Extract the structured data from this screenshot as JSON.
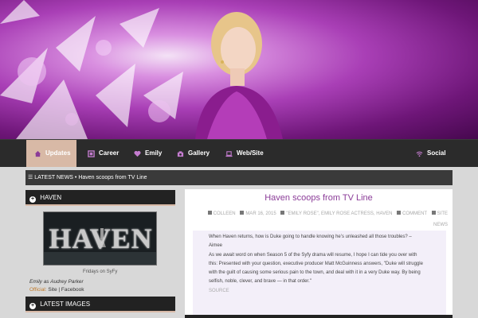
{
  "nav": {
    "items": [
      {
        "label": "Updates",
        "icon": "home-icon",
        "active": true
      },
      {
        "label": "Career",
        "icon": "film-icon"
      },
      {
        "label": "Emily",
        "icon": "heart-icon"
      },
      {
        "label": "Gallery",
        "icon": "camera-icon"
      },
      {
        "label": "Web/Site",
        "icon": "laptop-icon"
      },
      {
        "label": "Social",
        "icon": "wifi-icon"
      }
    ]
  },
  "ticker": {
    "prefix": "☰ LATEST NEWS •",
    "headline": "Haven scoops from TV Line"
  },
  "sidebar": {
    "haven_widget": {
      "title": "HAVEN",
      "logo_text": "HAVEN",
      "caption": "Fridays on SyFy",
      "role": "Emily as Audrey Parker",
      "official_label": "Official:",
      "site_link": "Site",
      "separator": "|",
      "facebook_link": "Facebook"
    },
    "images_widget": {
      "title": "LATEST IMAGES"
    }
  },
  "post": {
    "title": "Haven scoops from TV Line",
    "author": "COLLEEN",
    "date": "MAR 16, 2015",
    "tags": "\"EMILY ROSE\", EMILY ROSE ACTRESS, HAVEN",
    "comment": "COMMENT",
    "category": "SITE NEWS",
    "quote_lines": [
      "When Haven returns, how is Duke going to handle knowing he’s unleashed all those troubles? –",
      "Aimee",
      "As we await word on when Season 5 of the Syfy drama will resume, I hope I can tide you over with",
      "this: Presented with your question, executive producer Matt McGuinness answers, \"Duke will struggle",
      "with the guilt of causing some serious pain to the town, and deal with it in a very Duke way. By being",
      "selfish, noble, clever, and brave — in that order.\""
    ],
    "source": "SOURCE"
  },
  "colors": {
    "accent": "#8b3c98",
    "nav_bg": "#2b2b2b",
    "active_tab": "#d8b9a6"
  }
}
